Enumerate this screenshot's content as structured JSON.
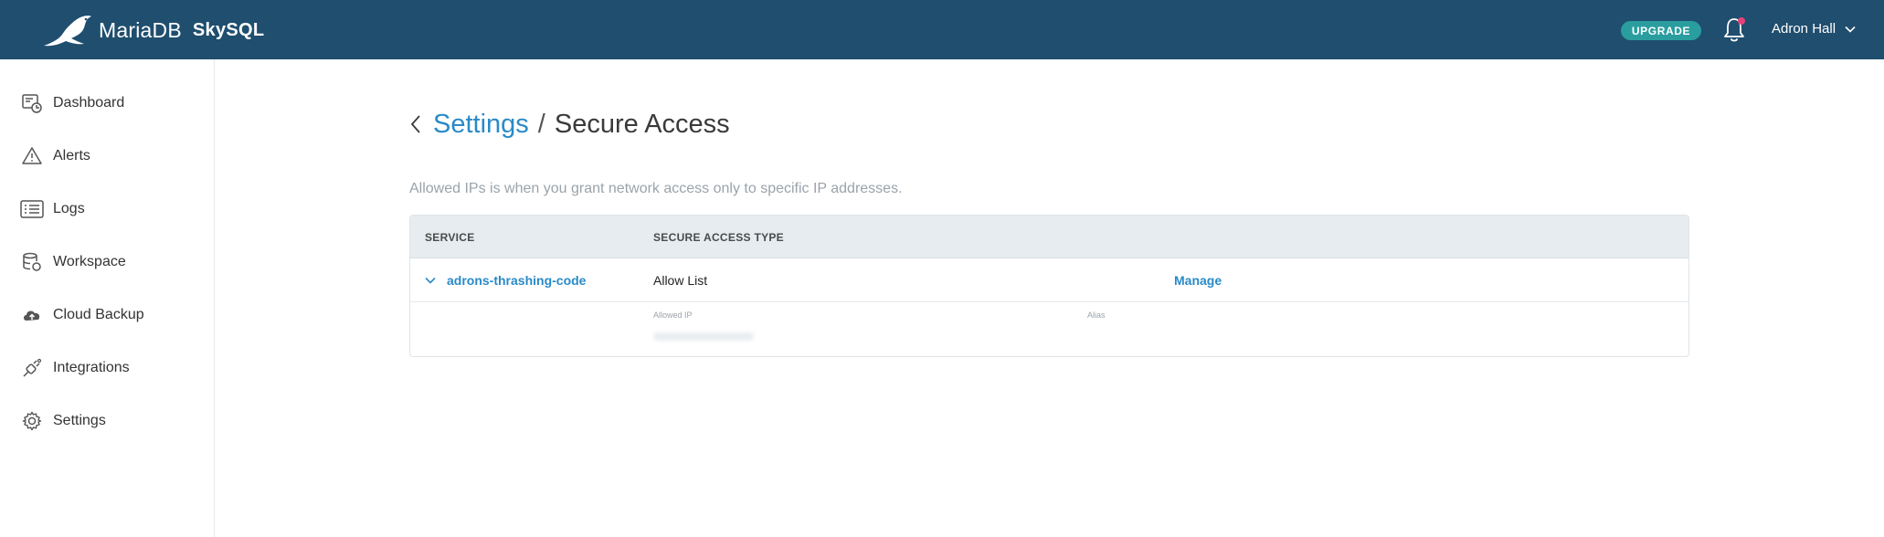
{
  "header": {
    "brand_name": "MariaDB",
    "product_name": "SkySQL",
    "upgrade_label": "UPGRADE",
    "user_name": "Adron Hall",
    "notification_dot_color": "#e8417a"
  },
  "sidebar": {
    "items": [
      {
        "label": "Dashboard",
        "icon": "dashboard-icon"
      },
      {
        "label": "Alerts",
        "icon": "alert-triangle-icon"
      },
      {
        "label": "Logs",
        "icon": "logs-icon"
      },
      {
        "label": "Workspace",
        "icon": "workspace-icon"
      },
      {
        "label": "Cloud Backup",
        "icon": "cloud-upload-icon"
      },
      {
        "label": "Integrations",
        "icon": "plug-icon"
      },
      {
        "label": "Settings",
        "icon": "gear-icon"
      }
    ]
  },
  "breadcrumb": {
    "parent": "Settings",
    "separator": "/",
    "current": "Secure Access"
  },
  "description": "Allowed IPs is when you grant network access only to specific IP addresses.",
  "table": {
    "columns": [
      "SERVICE",
      "SECURE ACCESS TYPE"
    ],
    "rows": [
      {
        "service": "adrons-thrashing-code",
        "access_type": "Allow List",
        "action": "Manage",
        "details": {
          "allowed_ip_label": "Allowed IP",
          "alias_label": "Alias"
        }
      }
    ]
  },
  "colors": {
    "topbar": "#1f4e6e",
    "accent": "#2a8ac7",
    "upgrade": "#2a9d9f"
  }
}
